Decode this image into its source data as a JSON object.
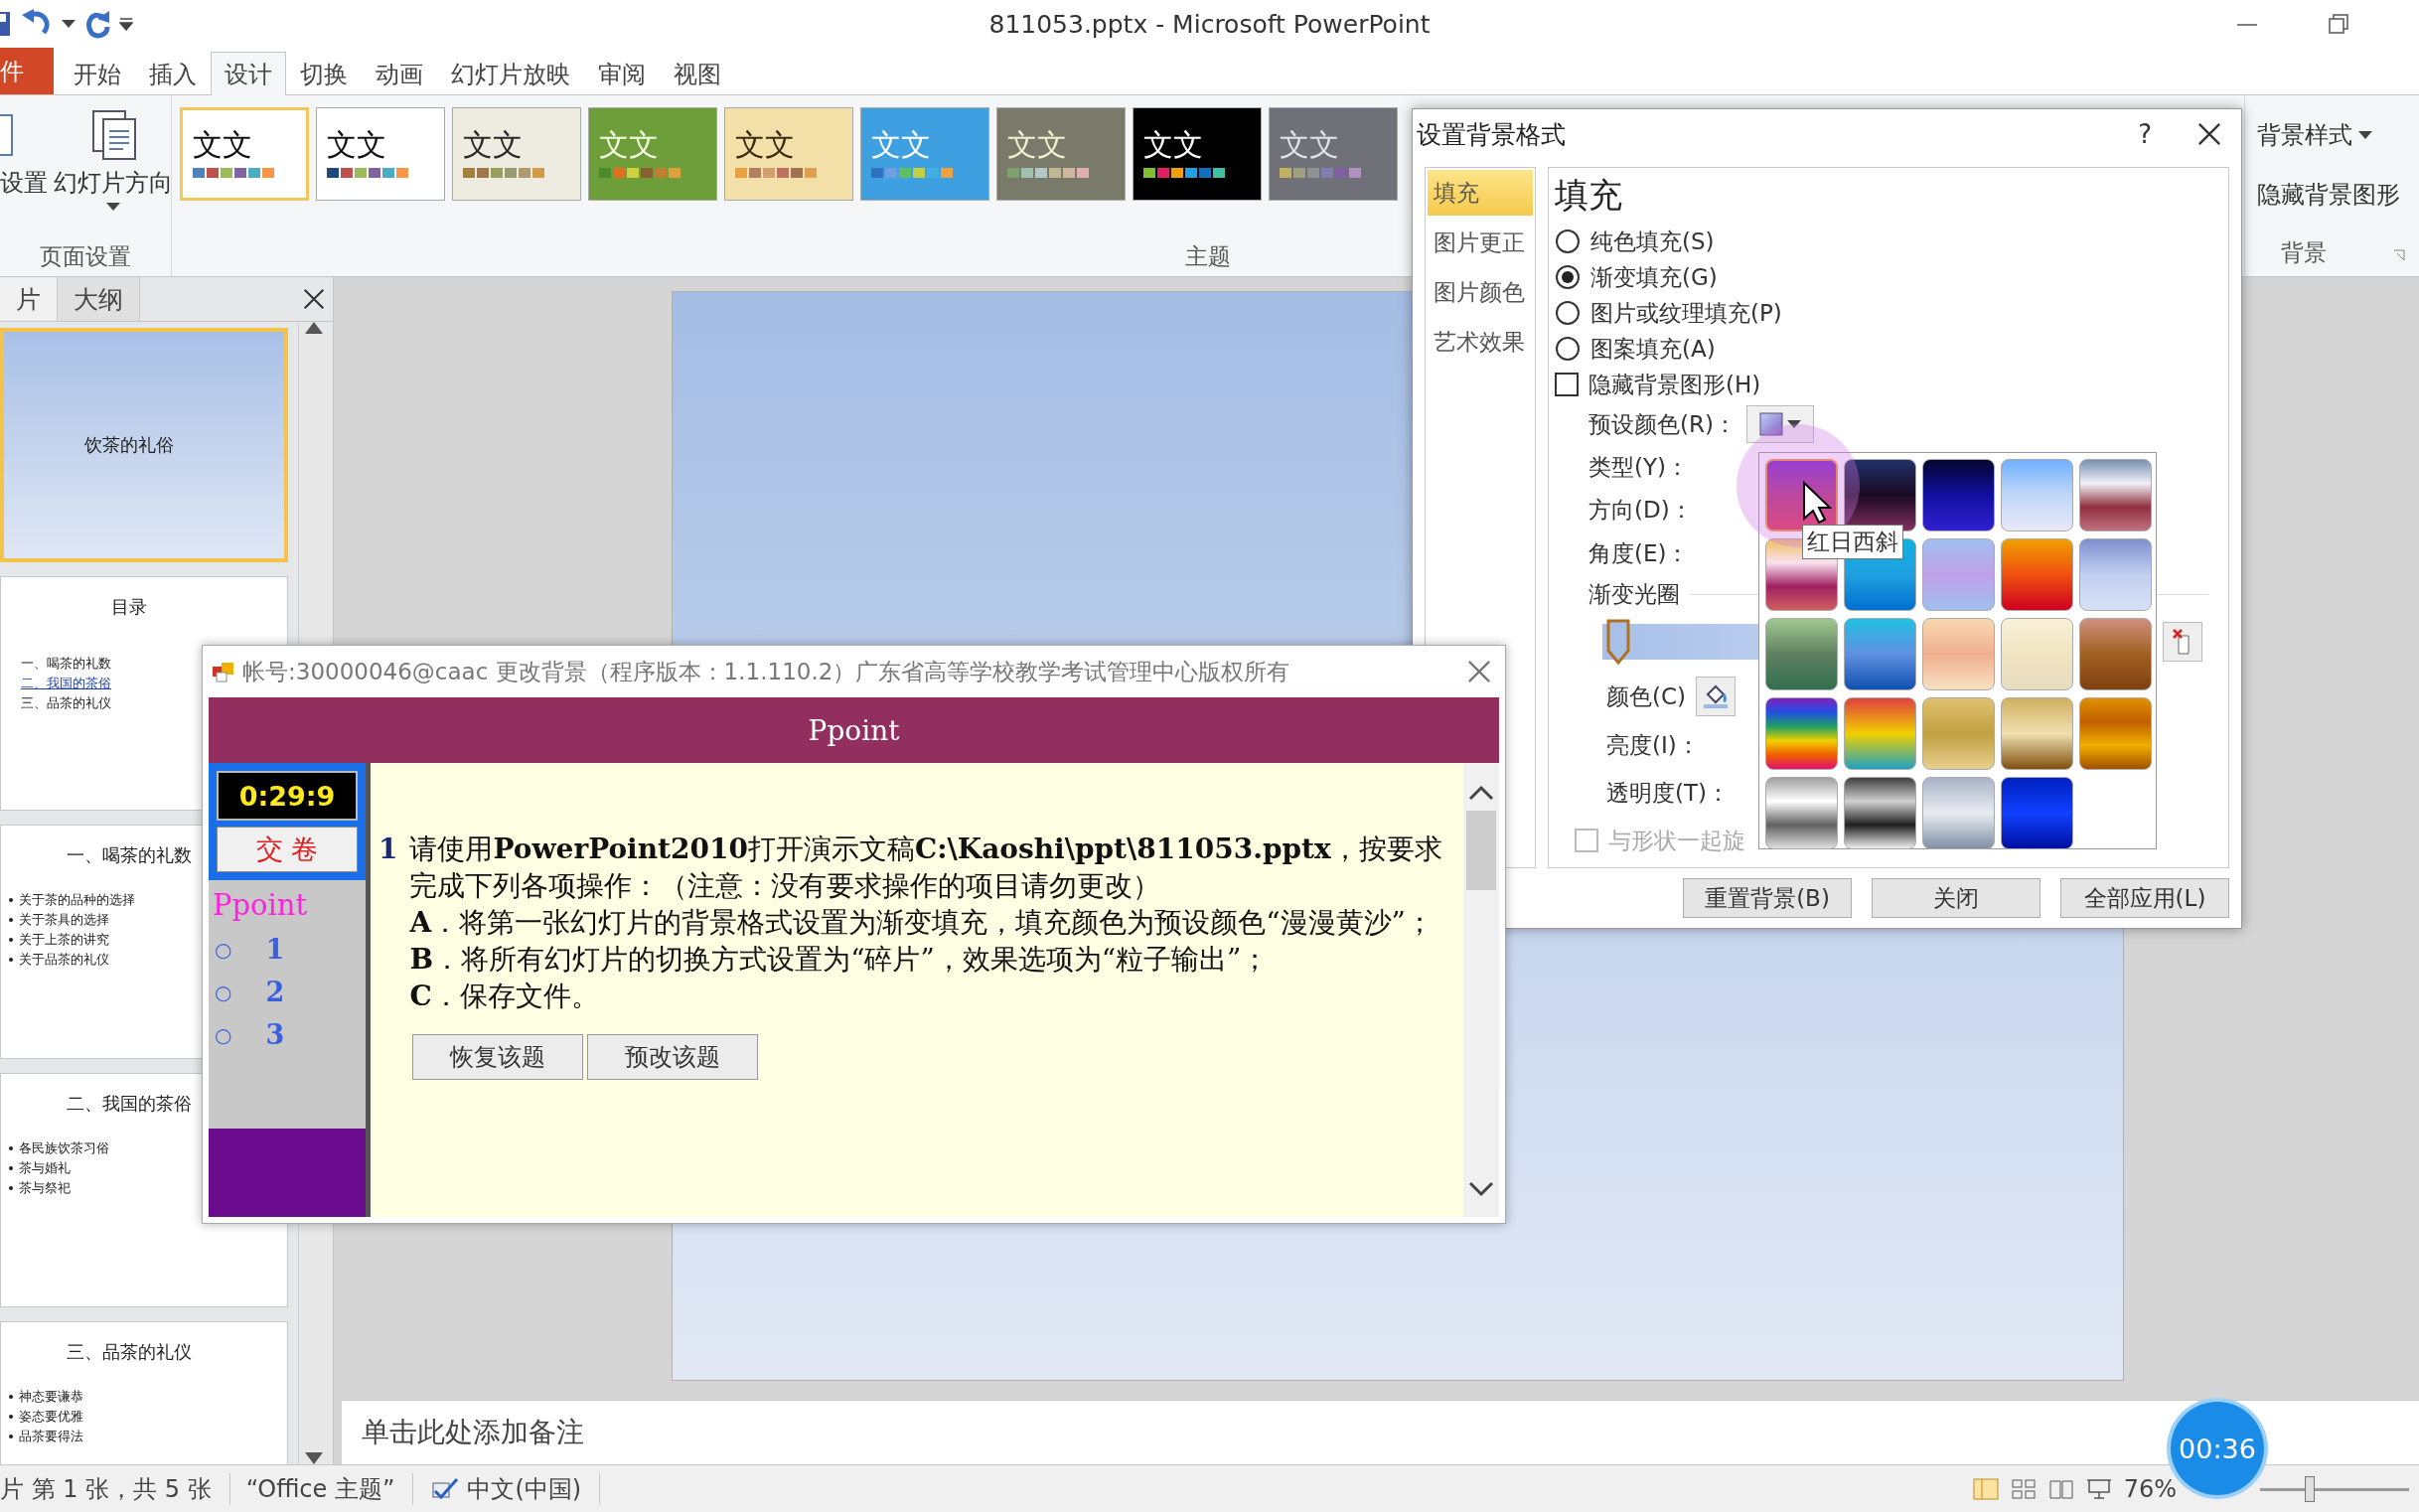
{
  "window": {
    "title": "811053.pptx - Microsoft PowerPoint"
  },
  "file_tab": {
    "label": "件"
  },
  "tabs": [
    {
      "label": "开始",
      "selected": false
    },
    {
      "label": "插入",
      "selected": false
    },
    {
      "label": "设计",
      "selected": true
    },
    {
      "label": "切换",
      "selected": false
    },
    {
      "label": "动画",
      "selected": false
    },
    {
      "label": "幻灯片放映",
      "selected": false
    },
    {
      "label": "审阅",
      "selected": false
    },
    {
      "label": "视图",
      "selected": false
    }
  ],
  "ribbon": {
    "page_setup": {
      "buttons": [
        "设置",
        "幻灯片方向"
      ],
      "label": "页面设置"
    },
    "themes": {
      "label": "主题",
      "items": [
        {
          "label": "文文",
          "selected": true
        },
        {
          "label": "文文",
          "selected": false
        },
        {
          "label": "文文",
          "selected": false
        },
        {
          "label": "文文",
          "selected": false
        },
        {
          "label": "文文",
          "selected": false
        },
        {
          "label": "文文",
          "selected": false
        },
        {
          "label": "文文",
          "selected": false
        },
        {
          "label": "文文",
          "selected": false
        },
        {
          "label": "文文",
          "selected": false
        }
      ]
    },
    "background": {
      "style_button": "背景样式",
      "hide_graphics": "隐藏背景图形",
      "label": "背景"
    }
  },
  "slide_panel": {
    "tabs": [
      {
        "label": "片",
        "selected": true
      },
      {
        "label": "大纲",
        "selected": false
      }
    ],
    "slides": [
      {
        "kind": "title",
        "title": "饮茶的礼俗",
        "selected": true
      },
      {
        "kind": "toc",
        "title": "目录",
        "selected": false,
        "items": [
          {
            "text": "一、喝茶的礼数",
            "link": false
          },
          {
            "text": "二、我国的茶俗",
            "link": true
          },
          {
            "text": "三、品茶的礼仪",
            "link": false
          }
        ]
      },
      {
        "kind": "bullets",
        "title": "一、喝茶的礼数",
        "selected": false,
        "items": [
          {
            "text": "关于茶的品种的选择",
            "link": false
          },
          {
            "text": "关于茶具的选择",
            "link": false
          },
          {
            "text": "关于上茶的讲究",
            "link": false
          },
          {
            "text": "关于品茶的礼仪",
            "link": false
          }
        ]
      },
      {
        "kind": "bullets",
        "title": "二、我国的茶俗",
        "selected": false,
        "items": [
          {
            "text": "各民族饮茶习俗",
            "link": false
          },
          {
            "text": "茶与婚礼",
            "link": false
          },
          {
            "text": "茶与祭祀",
            "link": false
          }
        ]
      },
      {
        "kind": "bullets",
        "title": "三、品茶的礼仪",
        "selected": false,
        "items": [
          {
            "text": "神态要谦恭",
            "link": false
          },
          {
            "text": "姿态要优雅",
            "link": false
          },
          {
            "text": "品茶要得法",
            "link": false
          }
        ]
      }
    ]
  },
  "notes": {
    "placeholder": "单击此处添加备注"
  },
  "status_bar": {
    "slide": "片 第 1 张，共 5 张",
    "theme": "“Office 主题”",
    "language": "中文(中国)",
    "zoom": "76%",
    "zoom_slider": {
      "level": 0.3
    }
  },
  "timer_badge": {
    "text": "00:36"
  },
  "dialog": {
    "title": "设置背景格式",
    "help": "?",
    "nav": [
      {
        "label": "填充",
        "selected": true
      },
      {
        "label": "图片更正",
        "selected": false
      },
      {
        "label": "图片颜色",
        "selected": false
      },
      {
        "label": "艺术效果",
        "selected": false
      }
    ],
    "heading": "填充",
    "fill_options": [
      {
        "label": "纯色填充(S)",
        "selected": false
      },
      {
        "label": "渐变填充(G)",
        "selected": true
      },
      {
        "label": "图片或纹理填充(P)",
        "selected": false
      },
      {
        "label": "图案填充(A)",
        "selected": false
      }
    ],
    "hide_graphics": {
      "label": "隐藏背景图形(H)",
      "checked": false
    },
    "preset_label": "预设颜色(R)：",
    "type_label": "类型(Y)：",
    "direction_label": "方向(D)：",
    "angle_label": "角度(E)：",
    "stops_label": "渐变光圈",
    "color_label": "颜色(C)",
    "brightness_label": "亮度(I)：",
    "transparency_label": "透明度(T)：",
    "rotate_with_shape": {
      "label": "与形状一起旋",
      "checked": false,
      "disabled": true
    },
    "buttons": [
      "重置背景(B)",
      "关闭",
      "全部应用(L)"
    ]
  },
  "preset_popup": {
    "tooltip": "红日西斜",
    "swatches": [
      {
        "selected": true
      },
      {
        "selected": false
      },
      {
        "selected": false
      },
      {
        "selected": false
      },
      {
        "selected": false
      },
      {
        "selected": false
      },
      {
        "selected": false
      },
      {
        "selected": false
      },
      {
        "selected": false
      },
      {
        "selected": false
      },
      {
        "selected": false
      },
      {
        "selected": false
      },
      {
        "selected": false
      },
      {
        "selected": false
      },
      {
        "selected": false
      },
      {
        "selected": false
      },
      {
        "selected": false
      },
      {
        "selected": false
      },
      {
        "selected": false
      },
      {
        "selected": false
      },
      {
        "selected": false
      },
      {
        "selected": false
      },
      {
        "selected": false
      },
      {
        "selected": false
      }
    ]
  },
  "exam": {
    "title": "帐号:30000046@caac  更改背景（程序版本：1.1.110.2）广东省高等学校教学考试管理中心版权所有",
    "header": "Ppoint",
    "timer": "0:29:9",
    "submit": "交 卷",
    "subject": "Ppoint",
    "questions": [
      {
        "mark": "○",
        "number": "1"
      },
      {
        "mark": "○",
        "number": "2"
      },
      {
        "mark": "○",
        "number": "3"
      }
    ],
    "question": {
      "number": "1",
      "paragraphs": [
        "请使用**PowerPoint2010**打开演示文稿**C:\\Kaoshi\\ppt\\811053.pptx**，按要求完成下列各项操作：（注意：没有要求操作的项目请勿更改）",
        "**A**．将第一张幻灯片的背景格式设置为渐变填充，填充颜色为预设颜色“漫漫黄沙”；",
        "**B**．将所有幻灯片的切换方式设置为“碎片”，效果选项为“粒子输出”；",
        "**C**．保存文件。"
      ]
    },
    "buttons": [
      "恢复该题",
      "预改该题"
    ]
  }
}
